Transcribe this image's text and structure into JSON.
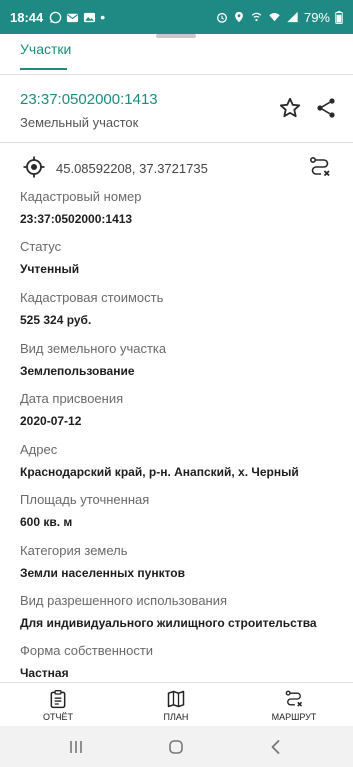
{
  "status_bar": {
    "time": "18:44",
    "battery": "79%"
  },
  "tabs": [
    {
      "label": "Участки"
    }
  ],
  "parcel": {
    "number": "23:37:0502000:1413",
    "type": "Земельный участок"
  },
  "coordinates": "45.08592208, 37.3721735",
  "fields": [
    {
      "label": "Кадастровый номер",
      "value": "23:37:0502000:1413"
    },
    {
      "label": "Статус",
      "value": "Учтенный"
    },
    {
      "label": "Кадастровая стоимость",
      "value": "525 324 руб."
    },
    {
      "label": "Вид земельного участка",
      "value": "Землепользование"
    },
    {
      "label": "Дата присвоения",
      "value": "2020-07-12"
    },
    {
      "label": "Адрес",
      "value": "Краснодарский край, р-н. Анапский, х. Черный"
    },
    {
      "label": "Площадь уточненная",
      "value": "600 кв. м"
    },
    {
      "label": "Категория земель",
      "value": "Земли населенных пунктов"
    },
    {
      "label": "Вид разрешенного использования",
      "value": "Для индивидуального жилищного строительства"
    },
    {
      "label": "Форма собственности",
      "value": "Частная"
    }
  ],
  "bottom_nav": [
    {
      "label": "ОТЧЁТ",
      "icon": "report-icon"
    },
    {
      "label": "ПЛАН",
      "icon": "map-icon"
    },
    {
      "label": "МАРШРУТ",
      "icon": "route-icon"
    }
  ],
  "colors": {
    "accent": "#1e8b7f",
    "status_bar": "#1f8a84"
  }
}
